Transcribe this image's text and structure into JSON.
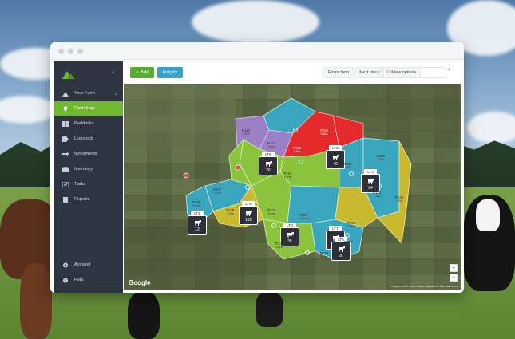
{
  "sidebar": {
    "farm_label": "Your Farm",
    "items": [
      {
        "label": "Farm Map",
        "icon": "location-pin-icon",
        "active": true
      },
      {
        "label": "Paddocks",
        "icon": "grid-icon",
        "active": false
      },
      {
        "label": "Livestock",
        "icon": "tag-icon",
        "active": false
      },
      {
        "label": "Movements",
        "icon": "arrows-icon",
        "active": false
      },
      {
        "label": "Inventory",
        "icon": "box-icon",
        "active": false
      },
      {
        "label": "Tasks",
        "icon": "checklist-icon",
        "active": false
      },
      {
        "label": "Reports",
        "icon": "document-icon",
        "active": false
      },
      {
        "label": "Account",
        "icon": "gear-icon",
        "active": false
      },
      {
        "label": "Help",
        "icon": "help-icon",
        "active": false
      }
    ]
  },
  "toolbar": {
    "add_label": "Add",
    "insights_label": "Insights",
    "entire_farm_label": "Entire farm",
    "next_block_label": "Next block",
    "view_options_label": "View options",
    "filter_placeholder": "Filter..."
  },
  "map": {
    "brand": "Google",
    "attribution": "Imagery ©2018 CNES / Airbus, DigitalGlobe, Map data ©2018",
    "zoom_in": "+",
    "zoom_out": "−",
    "mobs": [
      {
        "id": "LT9",
        "count": "26"
      },
      {
        "id": "LT6",
        "count": "40"
      },
      {
        "id": "LT4",
        "count": "24"
      },
      {
        "id": "LT8",
        "count": "102"
      },
      {
        "id": "LT1",
        "count": "12"
      },
      {
        "id": "LT3",
        "count": "35"
      },
      {
        "id": "LT7",
        "count": "66"
      },
      {
        "id": "LT5",
        "count": "20"
      }
    ],
    "paddocks": [
      {
        "name": "P113",
        "area": "4.1ha"
      },
      {
        "name": "P114",
        "area": "6.3ha"
      },
      {
        "name": "P116",
        "area": "5.6ha"
      },
      {
        "name": "P115",
        "area": "4.4ha"
      },
      {
        "name": "P117",
        "area": "4.8ha"
      },
      {
        "name": "P118",
        "area": "6.2ha"
      },
      {
        "name": "P119",
        "area": "5.3ha"
      },
      {
        "name": "P120",
        "area": "7.3ha"
      },
      {
        "name": "P122",
        "area": "6.9ha"
      },
      {
        "name": "P123",
        "area": "5.2ha"
      },
      {
        "name": "P124",
        "area": "6.8ha"
      },
      {
        "name": "P125",
        "area": "5.8ha"
      },
      {
        "name": "P126",
        "area": "6.4ha"
      },
      {
        "name": "P127",
        "area": "4.1ha"
      },
      {
        "name": "P128",
        "area": "7.2ha"
      },
      {
        "name": "P129",
        "area": "6.3ha"
      },
      {
        "name": "P121",
        "area": "4.8ha"
      },
      {
        "name": "P131",
        "area": "6.3ha"
      }
    ]
  },
  "colors": {
    "accent_green": "#58ac32",
    "insights_blue": "#3aa2c8",
    "sidebar_bg": "#2e3440",
    "paddock_purple": "#9b7fc7",
    "paddock_teal": "#3aa6be",
    "paddock_red": "#e42a2a",
    "paddock_green": "#8bc43c",
    "paddock_yellow": "#c9b92e"
  }
}
